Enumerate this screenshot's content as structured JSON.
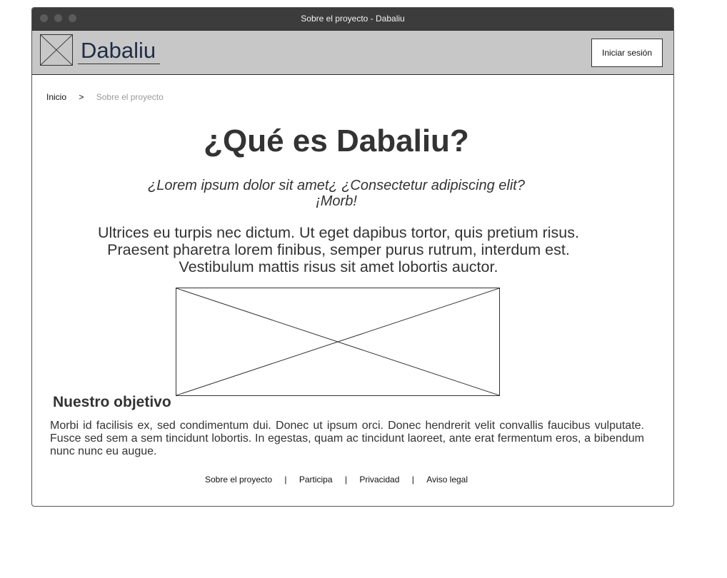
{
  "window": {
    "title": "Sobre el proyecto - Dabaliu"
  },
  "header": {
    "brand": "Dabaliu",
    "login_label": "Iniciar sesión"
  },
  "breadcrumb": {
    "home": "Inicio",
    "separator": ">",
    "current": "Sobre el proyecto"
  },
  "main": {
    "title": "¿Qué es Dabaliu?",
    "subtitle_line1": "¿Lorem ipsum dolor sit amet¿ ¿Consectetur adipiscing elit?",
    "subtitle_line2": "¡Morb!",
    "intro_line1": "Ultrices eu turpis nec dictum. Ut eget dapibus tortor, quis pretium risus.",
    "intro_line2": "Praesent pharetra lorem finibus, semper purus rutrum, interdum est.",
    "intro_line3": "Vestibulum mattis risus sit amet lobortis auctor.",
    "section_title": "Nuestro objetivo",
    "section_text": "Morbi id facilisis ex, sed condimentum dui. Donec ut ipsum orci. Donec hendrerit velit convallis faucibus vulputate. Fusce sed sem a sem tincidunt lobortis. In egestas, quam ac tincidunt laoreet, ante erat fermentum eros, a bibendum nunc nunc eu augue."
  },
  "footer": {
    "links": [
      "Sobre el proyecto",
      "Participa",
      "Privacidad",
      "Aviso legal"
    ],
    "separator": "|"
  },
  "colors": {
    "titlebar": "#3c3c3c",
    "header_bg": "#c7c7c7",
    "brand": "#1f2d46",
    "breadcrumb_current": "#9a9a9a"
  }
}
